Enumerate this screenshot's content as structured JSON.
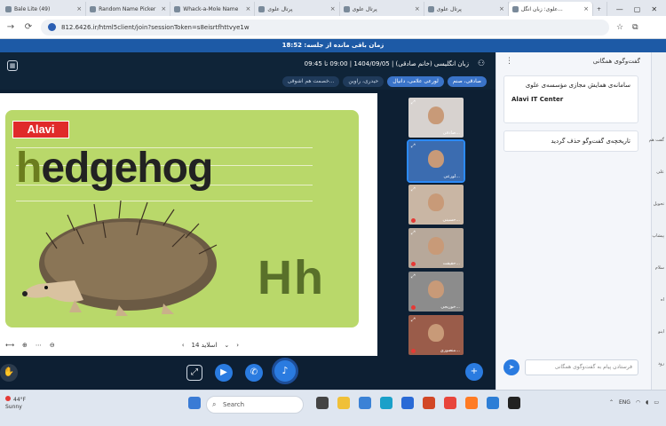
{
  "browser": {
    "tabs": [
      {
        "label": "Bale Lite (49)",
        "active": false
      },
      {
        "label": "Random Name Picker",
        "active": false
      },
      {
        "label": "Whack-a-Mole Name",
        "active": false
      },
      {
        "label": "پرتال علوی",
        "active": false
      },
      {
        "label": "پرتال علوی",
        "active": false
      },
      {
        "label": "پرتال علوی",
        "active": false
      },
      {
        "label": "علوی: زبان انگل...",
        "active": true
      }
    ],
    "url": "812.6426.ir/html5client/join?sessionToken=s8eisrtfhttvye1w",
    "new_tab": "+"
  },
  "session": {
    "timer_text": "زمان باقی مانده از جلسه: 18:52",
    "title": "زبان انگلیسی (خانم صادقی) | 1404/09/05 | 09:00 تا 09:45",
    "presenter_chips": [
      "صادقی، صنم",
      "لورعی علامی، دانیال",
      "حیدری، راوین",
      "خصمت هم اشوقی..."
    ]
  },
  "slide": {
    "brand": "Alavi",
    "word_first": "h",
    "word_rest": "edgehog",
    "letters": "Hh",
    "label": "اسلاید 14"
  },
  "videos": [
    {
      "name": "صادقی...",
      "mic": false,
      "selected": false
    },
    {
      "name": "لورعی...",
      "mic": false,
      "selected": true
    },
    {
      "name": "حسینی...",
      "mic": true,
      "selected": false
    },
    {
      "name": "حقیقت...",
      "mic": true,
      "selected": false
    },
    {
      "name": "خوریجی...",
      "mic": true,
      "selected": false
    },
    {
      "name": "منصوری...",
      "mic": true,
      "selected": false
    }
  ],
  "chat": {
    "header": "گفت‌وگوی همگانی",
    "welcome_title": "سامانه‌ی همایش مجازی مؤسسه‌ی علوی",
    "welcome_sub": "Alavi IT Center",
    "history_clear": "تاریخچه‌ی گفت‌وگو حذف گردید",
    "input_placeholder": "فرستادن پیام به گفت‌وگوی همگانی"
  },
  "edge_texts": [
    "گفت هم",
    "علی",
    "تحویل",
    "پیشاپ",
    "سلام",
    "اه",
    "اینو",
    "رود"
  ],
  "taskbar": {
    "temp": "44°F",
    "weather": "Sunny",
    "search": "Search",
    "lang": "ENG"
  },
  "colors": {
    "accent": "#2a7be0",
    "timer_bg": "#1d5aa6",
    "stage_bg": "#0d1f33",
    "brand_red": "#e02a2a"
  }
}
